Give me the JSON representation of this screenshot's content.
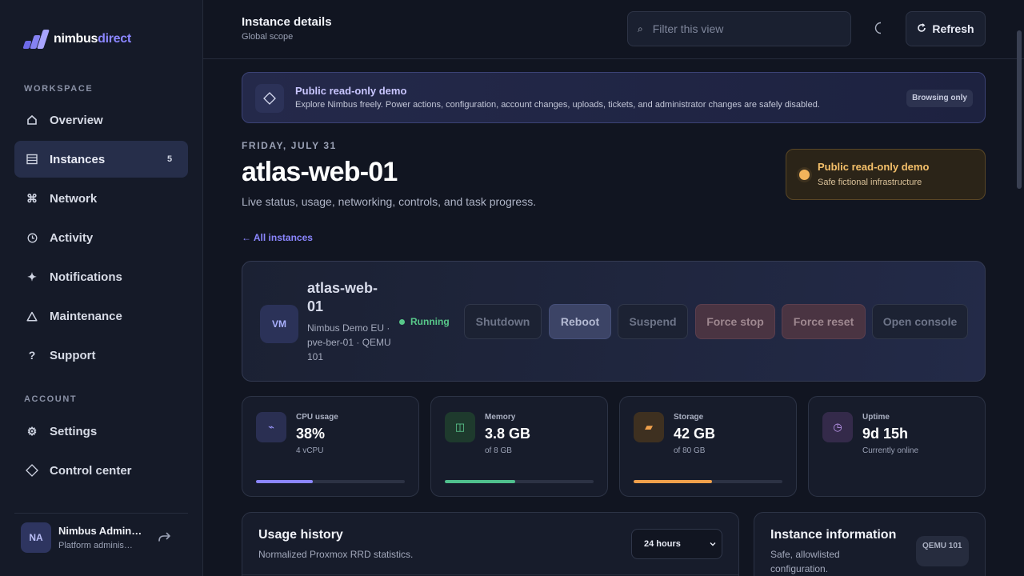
{
  "brand": {
    "name_a": "nimbus",
    "name_b": "direct"
  },
  "sidebar": {
    "workspace_label": "WORKSPACE",
    "account_label": "ACCOUNT",
    "items": [
      {
        "label": "Overview",
        "icon": "home-icon"
      },
      {
        "label": "Instances",
        "icon": "server-icon",
        "badge": "5"
      },
      {
        "label": "Network",
        "icon": "network-icon"
      },
      {
        "label": "Activity",
        "icon": "clock-icon"
      },
      {
        "label": "Notifications",
        "icon": "sparkle-icon"
      },
      {
        "label": "Maintenance",
        "icon": "warning-icon"
      },
      {
        "label": "Support",
        "icon": "help-icon"
      }
    ],
    "account_items": [
      {
        "label": "Settings",
        "icon": "gear-icon"
      },
      {
        "label": "Control center",
        "icon": "diamond-icon"
      }
    ],
    "user": {
      "initials": "NA",
      "name": "Nimbus Admin…",
      "role": "Platform adminis…"
    }
  },
  "header": {
    "title": "Instance details",
    "subtitle": "Global scope",
    "search_placeholder": "Filter this view",
    "refresh_label": "Refresh"
  },
  "banner": {
    "title": "Public read-only demo",
    "text": "Explore Nimbus freely. Power actions, configuration, account changes, uploads, tickets, and administrator changes are safely disabled.",
    "badge": "Browsing only"
  },
  "page": {
    "date": "FRIDAY, JULY 31",
    "title": "atlas-web-01",
    "subtitle": "Live status, usage, networking, controls, and task progress.",
    "back_link": "← All instances"
  },
  "demo_card": {
    "title": "Public read-only demo",
    "text": "Safe fictional infrastructure"
  },
  "instance": {
    "badge": "VM",
    "name": "atlas-web-01",
    "meta": "Nimbus Demo EU · pve-ber-01 · QEMU 101",
    "status": "Running",
    "actions": [
      "Shutdown",
      "Reboot",
      "Suspend",
      "Force stop",
      "Force reset",
      "Open console"
    ]
  },
  "stats": [
    {
      "label": "CPU usage",
      "value": "38%",
      "sub": "4 vCPU",
      "progress": 0.38,
      "color": "#8b86ff"
    },
    {
      "label": "Memory",
      "value": "3.8 GB",
      "sub": "of 8 GB",
      "progress": 0.475,
      "color": "#4fc08d"
    },
    {
      "label": "Storage",
      "value": "42 GB",
      "sub": "of 80 GB",
      "progress": 0.525,
      "color": "#f0a04b"
    },
    {
      "label": "Uptime",
      "value": "9d 15h",
      "sub": "Currently online"
    }
  ],
  "usage_panel": {
    "title": "Usage history",
    "subtitle": "Normalized Proxmox RRD statistics.",
    "range": "24 hours"
  },
  "info_panel": {
    "title": "Instance information",
    "subtitle": "Safe, allowlisted configuration.",
    "tag": "QEMU 101"
  }
}
